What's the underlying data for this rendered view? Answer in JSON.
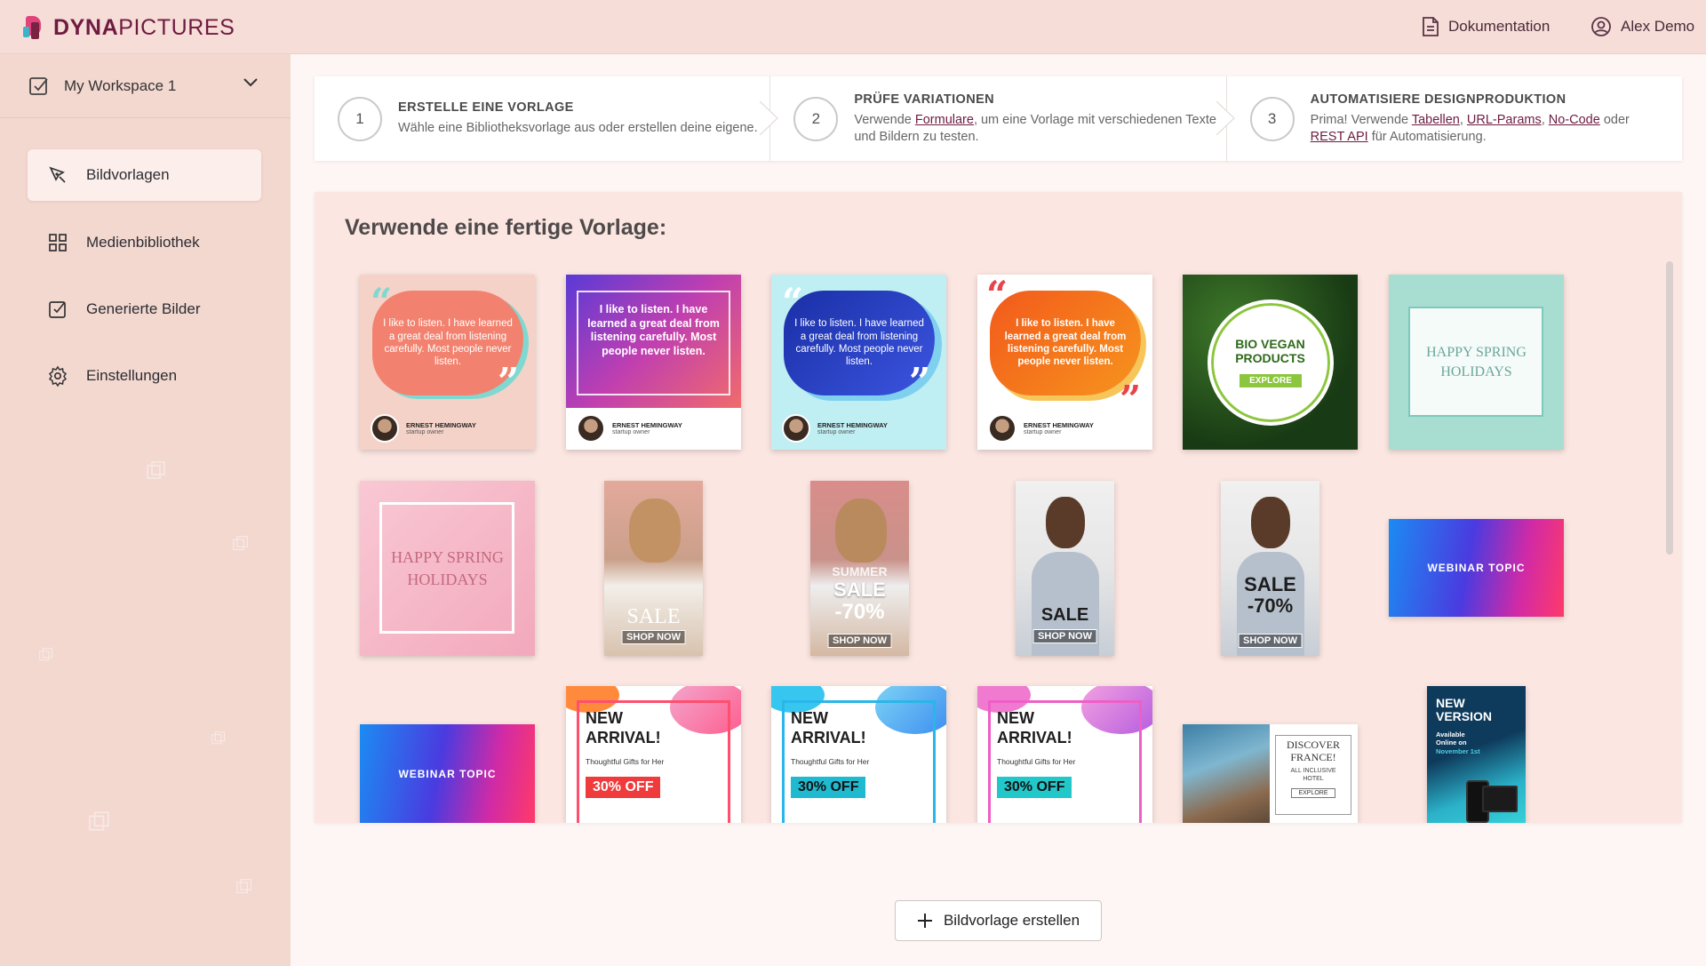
{
  "header": {
    "logo_bold": "DYNA",
    "logo_rest": "PICTURES",
    "docs_label": "Dokumentation",
    "user_label": "Alex Demo"
  },
  "sidebar": {
    "workspace": "My Workspace 1",
    "items": [
      {
        "label": "Bildvorlagen",
        "icon": "pen-tool-icon",
        "active": true
      },
      {
        "label": "Medienbibliothek",
        "icon": "grid-icon",
        "active": false
      },
      {
        "label": "Generierte Bilder",
        "icon": "check-square-icon",
        "active": false
      },
      {
        "label": "Einstellungen",
        "icon": "gear-icon",
        "active": false
      }
    ]
  },
  "steps": [
    {
      "num": "1",
      "title": "ERSTELLE EINE VORLAGE",
      "desc": "Wähle eine Bibliotheksvorlage aus oder erstellen deine eigene."
    },
    {
      "num": "2",
      "title": "PRÜFE VARIATIONEN",
      "desc_pre": "Verwende ",
      "link": "Formulare",
      "desc_post": ", um eine Vorlage mit verschiedenen Texten und Bildern zu testen."
    },
    {
      "num": "3",
      "title": "AUTOMATISIERE DESIGNPRODUKTION",
      "desc_pre": "Prima! Verwende ",
      "links": [
        "Tabellen",
        "URL-Params",
        "No-Code",
        "REST API"
      ],
      "sep1": ", ",
      "sep2": ", ",
      "sep3": " oder ",
      "desc_post": " für Automatisierung."
    }
  ],
  "templates": {
    "title": "Verwende eine fertige Vorlage:",
    "quote_text_light": "I like to listen. I have learned a great deal from listening carefully. Most people never listen.",
    "quote_text_bold": "I like to listen. I have learned a great deal from listening carefully. Most people never listen.",
    "quote_author": "ERNEST HEMINGWAY",
    "quote_role": "startup owner",
    "vegan_line1": "BIO VEGAN",
    "vegan_line2": "PRODUCTS",
    "vegan_btn": "EXPLORE",
    "spring_line1": "HAPPY SPRING",
    "spring_line2": "HOLIDAYS",
    "sale": "SALE",
    "summer": "SUMMER",
    "sale_pct": "-70%",
    "shop_now": "SHOP NOW",
    "webinar": "WEBINAR TOPIC",
    "arrival_line1": "NEW",
    "arrival_line2": "ARRIVAL!",
    "arrival_sub": "Thoughtful Gifts for Her",
    "arrival_off": "30% OFF",
    "france_line1": "DISCOVER",
    "france_line2": "FRANCE!",
    "france_sub1": "ALL INCLUSIVE",
    "france_sub2": "HOTEL",
    "france_btn": "EXPLORE",
    "version_line1": "NEW",
    "version_line2": "VERSION",
    "version_sub1": "Available",
    "version_sub2": "Online on",
    "version_date": "November 1st"
  },
  "create_button": "Bildvorlage erstellen",
  "colors": {
    "brand": "#6e1b40",
    "header_bg": "#f6ddd7",
    "sidebar_bg": "#f3d8d0",
    "panel_bg": "#fbe6e1"
  }
}
